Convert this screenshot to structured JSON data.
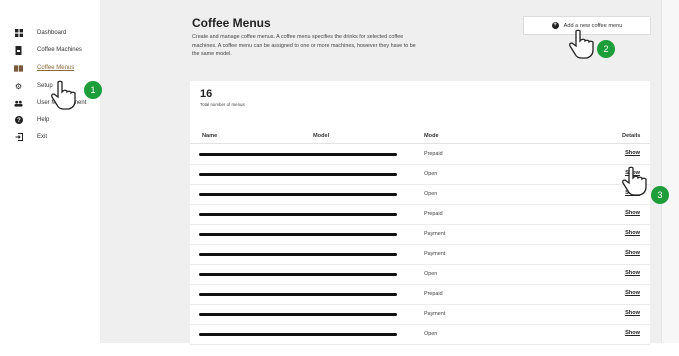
{
  "sidebar": {
    "items": [
      {
        "label": "Dashboard",
        "icon": "dashboard-icon"
      },
      {
        "label": "Coffee Machines",
        "icon": "coffee-machine-icon"
      },
      {
        "label": "Coffee Menus",
        "icon": "menu-book-icon",
        "active": true
      },
      {
        "label": "Setup",
        "icon": "gear-icon"
      },
      {
        "label": "User Management",
        "icon": "users-icon"
      },
      {
        "label": "Help",
        "icon": "help-icon"
      },
      {
        "label": "Exit",
        "icon": "exit-icon"
      }
    ]
  },
  "page": {
    "title": "Coffee Menus",
    "description": "Create and manage coffee menus. A coffee menu specifies the drinks for selected coffee machines. A coffee menu can be assigned to one or more machines, however they have to be the same model.",
    "add_button": "Add a new coffee menu"
  },
  "summary": {
    "count": "16",
    "count_label": "Total number of menus"
  },
  "table": {
    "headers": {
      "name": "Name",
      "model": "Model",
      "mode": "Mode",
      "details": "Details"
    },
    "rows": [
      {
        "mode": "Prepaid",
        "details": "Show"
      },
      {
        "mode": "Open",
        "details": "Show"
      },
      {
        "mode": "Open",
        "details": "Show"
      },
      {
        "mode": "Prepaid",
        "details": "Show"
      },
      {
        "mode": "Payment",
        "details": "Show"
      },
      {
        "mode": "Payment",
        "details": "Show"
      },
      {
        "mode": "Open",
        "details": "Show"
      },
      {
        "mode": "Prepaid",
        "details": "Show"
      },
      {
        "mode": "Payment",
        "details": "Show"
      },
      {
        "mode": "Open",
        "details": "Show"
      }
    ]
  },
  "annotations": {
    "step1": "1",
    "step2": "2",
    "step3": "3"
  },
  "colors": {
    "accent_green": "#1e9e3a",
    "active_link": "#8a6a3a",
    "main_background": "#efefef"
  }
}
